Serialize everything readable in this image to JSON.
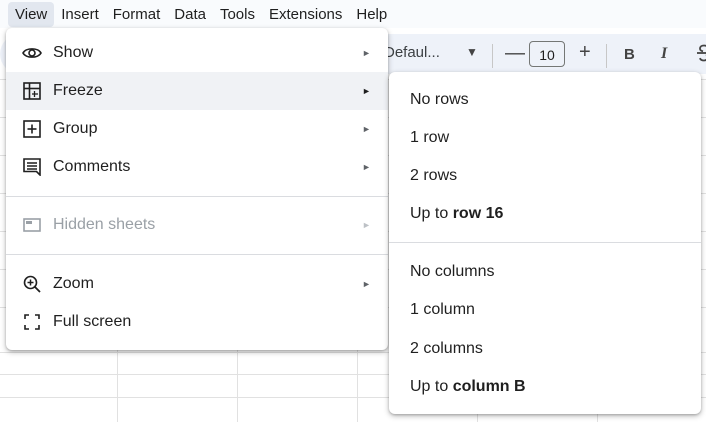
{
  "menubar": {
    "items": [
      "View",
      "Insert",
      "Format",
      "Data",
      "Tools",
      "Extensions",
      "Help"
    ]
  },
  "toolbar": {
    "font_name": "Defaul...",
    "font_size": "10",
    "minus": "—",
    "plus": "+",
    "bold": "B",
    "italic": "I",
    "strike": "S"
  },
  "view_menu": {
    "items": [
      {
        "label": "Show",
        "icon": "eye-icon",
        "has_submenu": true
      },
      {
        "label": "Freeze",
        "icon": "freeze-grid-icon",
        "has_submenu": true,
        "highlighted": true
      },
      {
        "label": "Group",
        "icon": "plus-box-icon",
        "has_submenu": true
      },
      {
        "label": "Comments",
        "icon": "comment-icon",
        "has_submenu": true
      },
      {
        "label": "Hidden sheets",
        "icon": "sheet-tab-icon",
        "has_submenu": true,
        "disabled": true
      },
      {
        "label": "Zoom",
        "icon": "zoom-in-icon",
        "has_submenu": true
      },
      {
        "label": "Full screen",
        "icon": "fullscreen-icon",
        "has_submenu": false
      }
    ],
    "arrow": "►"
  },
  "freeze_menu": {
    "rows": {
      "none": "No rows",
      "one": "1 row",
      "two": "2 rows",
      "upto_prefix": "Up to ",
      "upto_bold": "row 16"
    },
    "columns": {
      "none": "No columns",
      "one": "1 column",
      "two": "2 columns",
      "upto_prefix": "Up to ",
      "upto_bold": "column B"
    }
  },
  "colors": {
    "menu_highlight": "#f0f2f5",
    "menubar_bg": "#f9fbfd",
    "toolbar_bg": "#eef2f9",
    "disabled_text": "#9aa0a6"
  }
}
